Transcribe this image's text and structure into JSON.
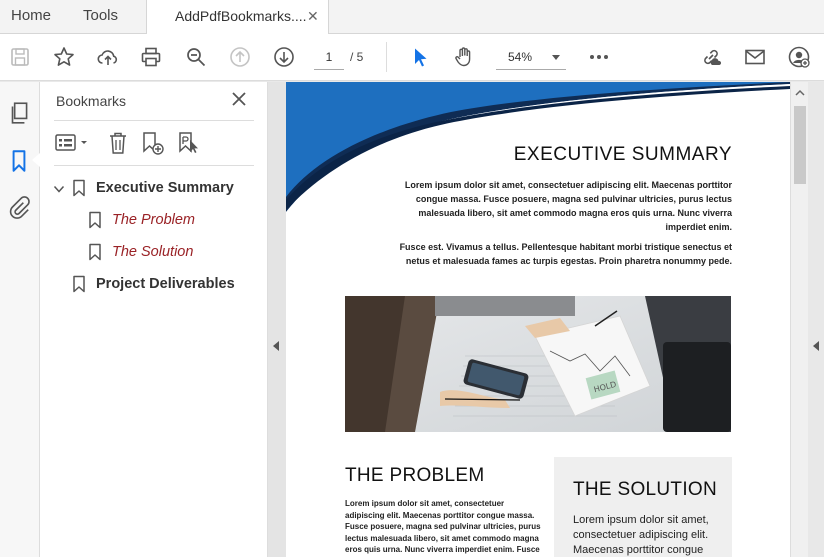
{
  "tabs": {
    "home": "Home",
    "tools": "Tools",
    "document": "AddPdfBookmarks....",
    "close_symbol": "✕"
  },
  "toolbar": {
    "page_current": "1",
    "page_total": "/ 5",
    "zoom": "54%",
    "icons": [
      "save-icon",
      "star-icon",
      "upload-icon",
      "print-icon",
      "zoom-out-icon",
      "page-up-icon",
      "page-down-icon",
      "select-arrow-icon",
      "hand-icon",
      "more-icon",
      "share-link-icon",
      "mail-icon",
      "user-add-icon"
    ]
  },
  "bookmarks": {
    "title": "Bookmarks",
    "items": [
      {
        "label": "Executive Summary",
        "level": 0,
        "expanded": true
      },
      {
        "label": "The Problem",
        "level": 1
      },
      {
        "label": "The Solution",
        "level": 1
      },
      {
        "label": "Project Deliverables",
        "level": 0
      }
    ]
  },
  "document": {
    "exec_title": "EXECUTIVE SUMMARY",
    "exec_p1": "Lorem ipsum dolor sit amet, consectetuer adipiscing elit. Maecenas porttitor congue massa. Fusce posuere, magna sed pulvinar ultricies, purus lectus malesuada libero, sit amet commodo magna eros quis urna. Nunc viverra imperdiet enim.",
    "exec_p2": "Fusce est. Vivamus a tellus. Pellentesque habitant morbi tristique senectus et netus et malesuada fames ac turpis egestas. Proin pharetra nonummy pede.",
    "problem_title": "THE PROBLEM",
    "problem_text": "Lorem ipsum dolor sit amet, consectetuer adipiscing elit. Maecenas porttitor congue massa. Fusce posuere, magna sed pulvinar ultricies, purus lectus malesuada libero, sit amet commodo magna eros quis urna. Nunc viverra imperdiet enim. Fusce est.",
    "solution_title": "THE SOLUTION",
    "solution_text": "Lorem ipsum dolor sit amet, consectetuer adipiscing elit. Maecenas porttitor congue",
    "photo_label": "HOLD"
  },
  "colors": {
    "accent_blue": "#1e6fbf",
    "dark_navy": "#0f2c54",
    "bookmark_red": "#9a2226",
    "pointer_blue": "#1473e6"
  }
}
